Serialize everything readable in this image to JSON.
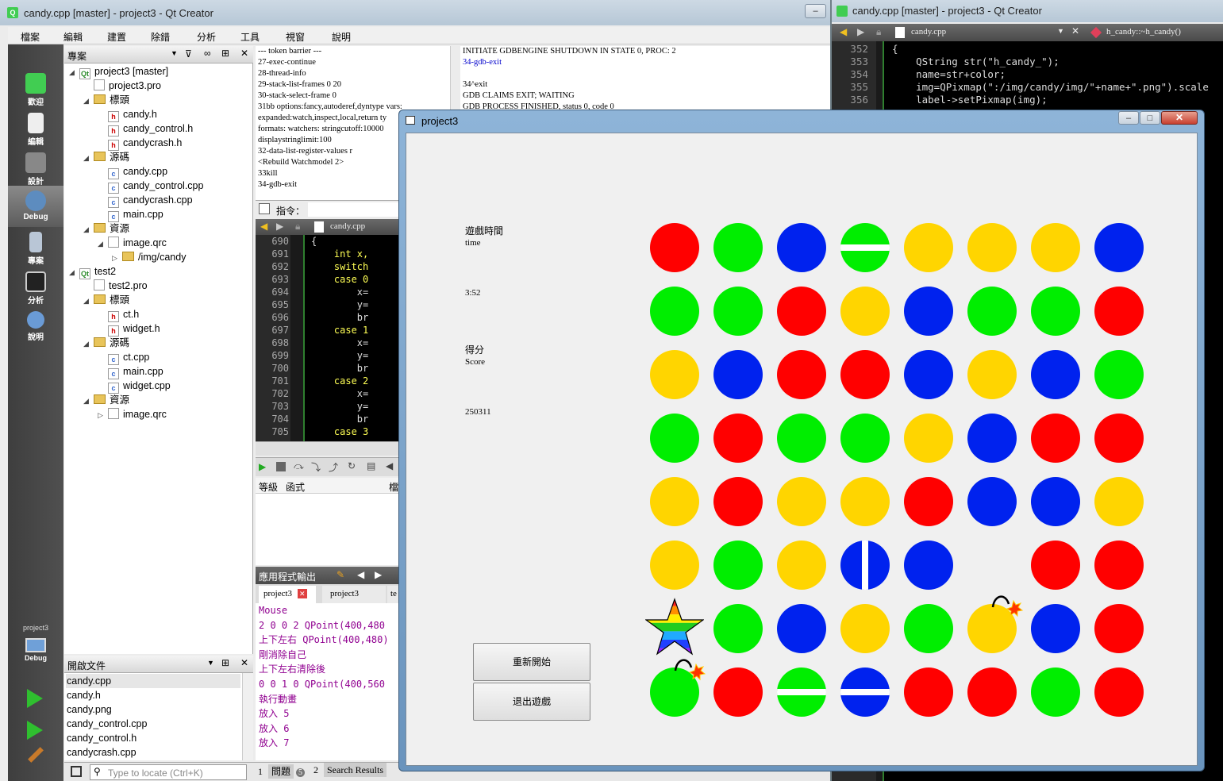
{
  "qtcreator": {
    "title": "candy.cpp [master] - project3 - Qt Creator",
    "menu": [
      "檔案",
      "編輯",
      "建置",
      "除錯",
      "分析",
      "工具",
      "視窗",
      "說明"
    ],
    "modes": [
      {
        "label": "歡迎",
        "icon": "qt-logo-icon"
      },
      {
        "label": "編輯",
        "icon": "document-icon"
      },
      {
        "label": "設計",
        "icon": "design-tools-icon"
      },
      {
        "label": "Debug",
        "icon": "debug-bug-icon"
      },
      {
        "label": "專案",
        "icon": "project-wrench-icon"
      },
      {
        "label": "分析",
        "icon": "analyze-icon"
      },
      {
        "label": "說明",
        "icon": "help-icon"
      }
    ],
    "kit_label": "project3",
    "kit_mode": "Debug",
    "projects_header": "專案",
    "tree": [
      {
        "text": "project3 [master]",
        "depth": 0,
        "kind": "project",
        "open": true,
        "bold": false
      },
      {
        "text": "project3.pro",
        "depth": 1,
        "kind": "pro"
      },
      {
        "text": "標頭",
        "depth": 1,
        "kind": "folder",
        "open": true
      },
      {
        "text": "candy.h",
        "depth": 2,
        "kind": "h"
      },
      {
        "text": "candy_control.h",
        "depth": 2,
        "kind": "h"
      },
      {
        "text": "candycrash.h",
        "depth": 2,
        "kind": "h"
      },
      {
        "text": "源碼",
        "depth": 1,
        "kind": "folder",
        "open": true
      },
      {
        "text": "candy.cpp",
        "depth": 2,
        "kind": "cpp"
      },
      {
        "text": "candy_control.cpp",
        "depth": 2,
        "kind": "cpp"
      },
      {
        "text": "candycrash.cpp",
        "depth": 2,
        "kind": "cpp"
      },
      {
        "text": "main.cpp",
        "depth": 2,
        "kind": "cpp"
      },
      {
        "text": "資源",
        "depth": 1,
        "kind": "folder",
        "open": true
      },
      {
        "text": "image.qrc",
        "depth": 2,
        "kind": "qrc",
        "open": true
      },
      {
        "text": "/img/candy",
        "depth": 3,
        "kind": "folder",
        "open": false
      },
      {
        "text": "test2",
        "depth": 0,
        "kind": "project",
        "open": true
      },
      {
        "text": "test2.pro",
        "depth": 1,
        "kind": "pro"
      },
      {
        "text": "標頭",
        "depth": 1,
        "kind": "folder",
        "open": true
      },
      {
        "text": "ct.h",
        "depth": 2,
        "kind": "h"
      },
      {
        "text": "widget.h",
        "depth": 2,
        "kind": "h"
      },
      {
        "text": "源碼",
        "depth": 1,
        "kind": "folder",
        "open": true
      },
      {
        "text": "ct.cpp",
        "depth": 2,
        "kind": "cpp"
      },
      {
        "text": "main.cpp",
        "depth": 2,
        "kind": "cpp"
      },
      {
        "text": "widget.cpp",
        "depth": 2,
        "kind": "cpp"
      },
      {
        "text": "資源",
        "depth": 1,
        "kind": "folder",
        "open": true
      },
      {
        "text": "image.qrc",
        "depth": 2,
        "kind": "qrc",
        "open": false
      }
    ],
    "open_docs_header": "開啟文件",
    "open_docs": [
      "candy.cpp",
      "candy.h",
      "candy.png",
      "candy_control.cpp",
      "candy_control.h",
      "candycrash.cpp"
    ],
    "locate_placeholder": "Type to locate (Ctrl+K)",
    "status_tabs": [
      {
        "num": "1",
        "label": "問題",
        "badge": "5"
      },
      {
        "num": "2",
        "label": "Search Results"
      }
    ],
    "gdb_log": [
      "--- token barrier ---",
      "27-exec-continue",
      "28-thread-info",
      "29-stack-list-frames 0 20",
      "30-stack-select-frame 0",
      "31bb options:fancy,autoderef,dyntype vars:",
      "expanded:watch,inspect,local,return ty",
      "formats: watchers: stringcutoff:10000",
      "displaystringlimit:100",
      "32-data-list-register-values r",
      "<Rebuild Watchmodel 2>",
      "33kill",
      "34-gdb-exit"
    ],
    "gdb_log2": [
      {
        "text": "INITIATE GDBENGINE SHUTDOWN IN STATE 0, PROC: 2",
        "blue": false
      },
      {
        "text": "34-gdb-exit",
        "blue": true
      },
      {
        "text": "",
        "blue": false
      },
      {
        "text": "34^exit",
        "blue": false
      },
      {
        "text": "GDB CLAIMS EXIT; WAITING",
        "blue": false
      },
      {
        "text": "GDB PROCESS FINISHED, status 0, code 0",
        "blue": false
      }
    ],
    "command_label": "指令：",
    "editor_file": "candy.cpp",
    "editor_lines": [
      {
        "n": "690",
        "c": "{"
      },
      {
        "n": "691",
        "c": "    int x,"
      },
      {
        "n": "692",
        "c": "    switch"
      },
      {
        "n": "693",
        "c": "    case 0"
      },
      {
        "n": "694",
        "c": "        x="
      },
      {
        "n": "695",
        "c": "        y="
      },
      {
        "n": "696",
        "c": "        br"
      },
      {
        "n": "697",
        "c": "    case 1"
      },
      {
        "n": "698",
        "c": "        x="
      },
      {
        "n": "699",
        "c": "        y="
      },
      {
        "n": "700",
        "c": "        br"
      },
      {
        "n": "701",
        "c": "    case 2"
      },
      {
        "n": "702",
        "c": "        x="
      },
      {
        "n": "703",
        "c": "        y="
      },
      {
        "n": "704",
        "c": "        br"
      },
      {
        "n": "705",
        "c": "    case 3"
      }
    ],
    "stack_headers": [
      "等級",
      "函式",
      "檔"
    ],
    "app_output_header": "應用程式輸出",
    "app_tabs": [
      "project3",
      "project3",
      "te"
    ],
    "app_output": [
      "Mouse",
      "2 0 0 2 QPoint(400,480",
      "上下左右 QPoint(400,480)",
      "剛消除自己",
      "上下左右清除後",
      "0 0 1 0 QPoint(400,560",
      "執行動畫",
      "放入 5",
      "放入 6",
      "放入 7"
    ]
  },
  "right_window": {
    "title": "candy.cpp [master] - project3 - Qt Creator",
    "file": "candy.cpp",
    "symbol": "h_candy::~h_candy()",
    "lines": [
      {
        "n": "352",
        "c": "{"
      },
      {
        "n": "353",
        "c": "    QString str(\"h_candy_\");"
      },
      {
        "n": "354",
        "c": "    name=str+color;"
      },
      {
        "n": "355",
        "c": "    img=QPixmap(\":/img/candy/img/\"+name+\".png\").scale"
      },
      {
        "n": "356",
        "c": "    label->setPixmap(img);"
      }
    ]
  },
  "game": {
    "title": "project3",
    "time_label_cn": "遊戲時間",
    "time_label_en": "time",
    "time_value": "3:52",
    "score_label_cn": "得分",
    "score_label_en": "Score",
    "score_value": "250311",
    "restart_button": "重新開始",
    "quit_button": "退出遊戲",
    "colors": {
      "r": "#ff0000",
      "g": "#00ee00",
      "b": "#0022ee",
      "y": "#ffd500"
    },
    "grid": [
      [
        "r",
        "g",
        "b",
        "gH",
        "y",
        "y",
        "y",
        "b"
      ],
      [
        "g",
        "g",
        "r",
        "y",
        "b",
        "g",
        "g",
        "r"
      ],
      [
        "y",
        "b",
        "r",
        "r",
        "b",
        "y",
        "b",
        "g"
      ],
      [
        "g",
        "r",
        "g",
        "g",
        "y",
        "b",
        "r",
        "r"
      ],
      [
        "y",
        "r",
        "y",
        "y",
        "r",
        "b",
        "b",
        "y"
      ],
      [
        "y",
        "g",
        "y",
        "bV",
        "b",
        "_",
        "r",
        "r"
      ],
      [
        "star",
        "g",
        "b",
        "y",
        "g",
        "yB",
        "b",
        "r"
      ],
      [
        "gB",
        "r",
        "gH",
        "bH",
        "r",
        "r",
        "g",
        "r"
      ]
    ]
  }
}
